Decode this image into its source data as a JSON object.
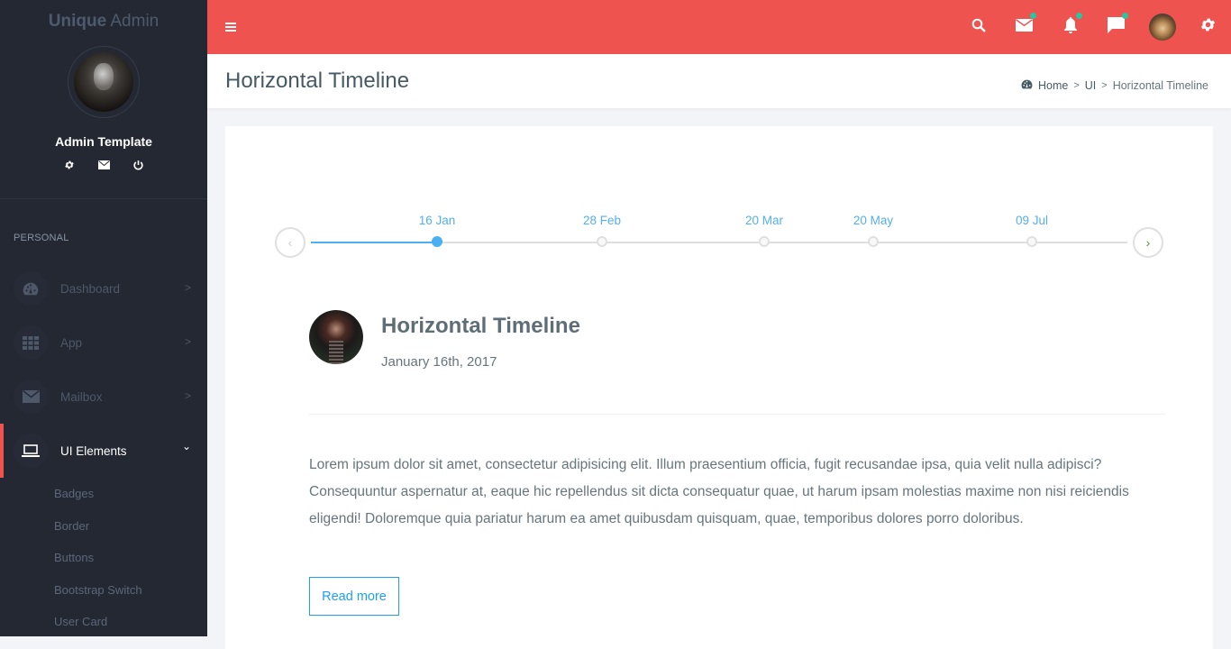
{
  "sidebar": {
    "brand_bold": "Unique",
    "brand_light": " Admin",
    "user_name": "Admin Template",
    "user_actions": [
      "gear-icon",
      "mail-icon",
      "power-icon"
    ],
    "section_header": "PERSONAL",
    "menu": [
      {
        "label": "Dashboard",
        "icon": "dashboard-gauge-icon",
        "chevron": ">"
      },
      {
        "label": "App",
        "icon": "grid-icon",
        "chevron": ">"
      },
      {
        "label": "Mailbox",
        "icon": "mail-icon",
        "chevron": ">"
      },
      {
        "label": "UI Elements",
        "icon": "laptop-icon",
        "chevron": "⌄",
        "active": true
      }
    ],
    "submenu": [
      "Badges",
      "Border",
      "Buttons",
      "Bootstrap Switch",
      "User Card"
    ]
  },
  "topbar": {
    "color": "#ef5350",
    "icons": [
      "search-icon",
      "mail-icon",
      "bell-icon",
      "chat-icon",
      "user-avatar",
      "gear-icon"
    ],
    "notification_dot_color": "#26c6a0"
  },
  "page": {
    "title": "Horizontal Timeline",
    "breadcrumb": [
      "Home",
      "UI",
      "Horizontal Timeline"
    ]
  },
  "timeline": {
    "prev_label": "‹",
    "next_label": "›",
    "events": [
      {
        "date": "16 Jan",
        "selected": true
      },
      {
        "date": "28 Feb",
        "selected": false
      },
      {
        "date": "20 Mar",
        "selected": false
      },
      {
        "date": "20 May",
        "selected": false
      },
      {
        "date": "09 Jul",
        "selected": false
      }
    ],
    "accent": "#4ab0f2"
  },
  "event": {
    "title": "Horizontal Timeline",
    "date": "January 16th, 2017",
    "body": "Lorem ipsum dolor sit amet, consectetur adipisicing elit. Illum praesentium officia, fugit recusandae ipsa, quia velit nulla adipisci? Consequuntur aspernatur at, eaque hic repellendus sit dicta consequatur quae, ut harum ipsam molestias maxime non nisi reiciendis eligendi! Doloremque quia pariatur harum ea amet quibusdam quisquam, quae, temporibus dolores porro doloribus.",
    "read_more": "Read more"
  }
}
